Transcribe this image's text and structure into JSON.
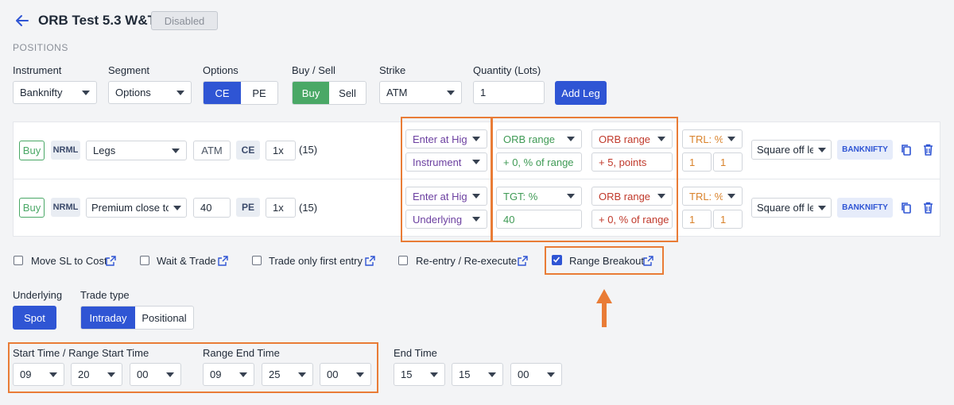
{
  "header": {
    "title": "ORB Test 5.3 W&T",
    "status": "Disabled"
  },
  "positions": {
    "section_label": "POSITIONS",
    "labels": {
      "instrument": "Instrument",
      "segment": "Segment",
      "options": "Options",
      "buy_sell": "Buy / Sell",
      "strike": "Strike",
      "quantity": "Quantity (Lots)"
    },
    "instrument_value": "Banknifty",
    "segment_value": "Options",
    "options": {
      "ce": "CE",
      "pe": "PE",
      "selected": "CE"
    },
    "buy_sell": {
      "buy": "Buy",
      "sell": "Sell",
      "selected": "Buy"
    },
    "strike_value": "ATM",
    "quantity_value": "1",
    "add_leg": "Add Leg"
  },
  "legs": [
    {
      "side": "Buy",
      "product": "NRML",
      "strike_mode": "Legs",
      "strike_value": "ATM",
      "option_type": "CE",
      "multiplier": "1x",
      "qty_note": "(15)",
      "entry": "Enter at High",
      "entry_ref": "Instrument",
      "target_type": "ORB range",
      "target_value": "+ 0, % of range",
      "sl_type": "ORB range",
      "sl_value": "+ 5, points",
      "trail_type": "TRL: %",
      "trail_a": "1",
      "trail_b": "1",
      "exit_action": "Square off leg",
      "symbol": "BANKNIFTY"
    },
    {
      "side": "Buy",
      "product": "NRML",
      "strike_mode": "Premium close to",
      "strike_value": "40",
      "option_type": "PE",
      "multiplier": "1x",
      "qty_note": "(15)",
      "entry": "Enter at High",
      "entry_ref": "Underlying",
      "target_type": "TGT: %",
      "target_value": "40",
      "sl_type": "ORB range",
      "sl_value": "+ 0, % of range",
      "trail_type": "TRL: %",
      "trail_a": "1",
      "trail_b": "1",
      "exit_action": "Square off leg",
      "symbol": "BANKNIFTY"
    }
  ],
  "toggles": [
    {
      "label": "Move SL to Cost",
      "checked": false
    },
    {
      "label": "Wait & Trade",
      "checked": false
    },
    {
      "label": "Trade only first entry",
      "checked": false
    },
    {
      "label": "Re-entry / Re-execute",
      "checked": false
    },
    {
      "label": "Range Breakout",
      "checked": true
    }
  ],
  "underlying": {
    "label": "Underlying",
    "value": "Spot"
  },
  "trade_type": {
    "label": "Trade type",
    "intraday": "Intraday",
    "positional": "Positional",
    "selected": "Intraday"
  },
  "timing": {
    "start_label": "Start Time / Range Start Time",
    "start": [
      "09",
      "20",
      "00"
    ],
    "range_end_label": "Range End Time",
    "range_end": [
      "09",
      "25",
      "00"
    ],
    "end_label": "End Time",
    "end": [
      "15",
      "15",
      "00"
    ]
  },
  "colors": {
    "accent": "#2f55d4",
    "buy_green": "#4aa866",
    "highlight": "#e97c36",
    "purple_text": "#6b3fa0",
    "green_text": "#3f9a55",
    "red_text": "#c0392b",
    "orange_text": "#d9822b"
  }
}
